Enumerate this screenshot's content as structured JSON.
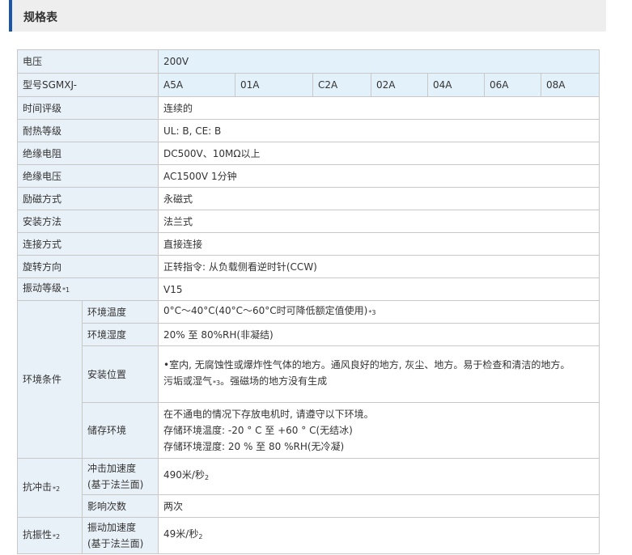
{
  "header": {
    "title": "规格表"
  },
  "rows": {
    "voltage": {
      "label": "电压",
      "value": "200V"
    },
    "model": {
      "label": "型号SGMXJ-",
      "codes": [
        "A5A",
        "01A",
        "C2A",
        "02A",
        "04A",
        "06A",
        "08A"
      ]
    },
    "time_rating": {
      "label": "时间评级",
      "value": "连续的"
    },
    "heat_class": {
      "label": "耐热等级",
      "value": "UL: B, CE: B"
    },
    "insulation_resistance": {
      "label": "绝缘电阻",
      "value": "DC500V、10MΩ以上"
    },
    "insulation_voltage": {
      "label": "绝缘电压",
      "value": "AC1500V 1分钟"
    },
    "excitation": {
      "label": "励磁方式",
      "value": "永磁式"
    },
    "mounting": {
      "label": "安装方法",
      "value": "法兰式"
    },
    "connection": {
      "label": "连接方式",
      "value": "直接连接"
    },
    "rotation": {
      "label": "旋转方向",
      "value": "正转指令: 从负载侧看逆时针(CCW)"
    },
    "vibration_class": {
      "label": "振动等级",
      "note": "*1",
      "value": "V15"
    },
    "environment": {
      "label": "环境条件",
      "temp": {
        "label": "环境温度",
        "value": "0°C～40°C(40°C～60°C时可降低额定值使用)",
        "note": "*3"
      },
      "humidity": {
        "label": "环境湿度",
        "value": "20% 至 80%RH(非凝结)"
      },
      "location": {
        "label": "安装位置",
        "line1": "•室内, 无腐蚀性或爆炸性气体的地方。通风良好的地方, 灰尘、地方。易于检查和清洁的地方。",
        "line2a": "污垢或湿气",
        "note": "*3",
        "line2b": "。强磁场的地方没有生成"
      },
      "storage": {
        "label": "储存环境",
        "line1": "在不通电的情况下存放电机时, 请遵守以下环境。",
        "line2": "存储环境温度: -20 ° C 至 +60 ° C(无结冰)",
        "line3": "存储环境湿度: 20 % 至 80 %RH(无冷凝)"
      }
    },
    "shock": {
      "label": "抗冲击",
      "note": "*2",
      "accel_label_1": "冲击加速度",
      "accel_label_2": "(基于法兰面)",
      "accel_value": "490米/秒",
      "accel_exp": "2",
      "count_label": "影响次数",
      "count_value": "两次"
    },
    "vibration": {
      "label": "抗振性",
      "note": "*2",
      "accel_label_1": "振动加速度",
      "accel_label_2": "(基于法兰面)",
      "accel_value": "49米/秒",
      "accel_exp": "2"
    }
  }
}
